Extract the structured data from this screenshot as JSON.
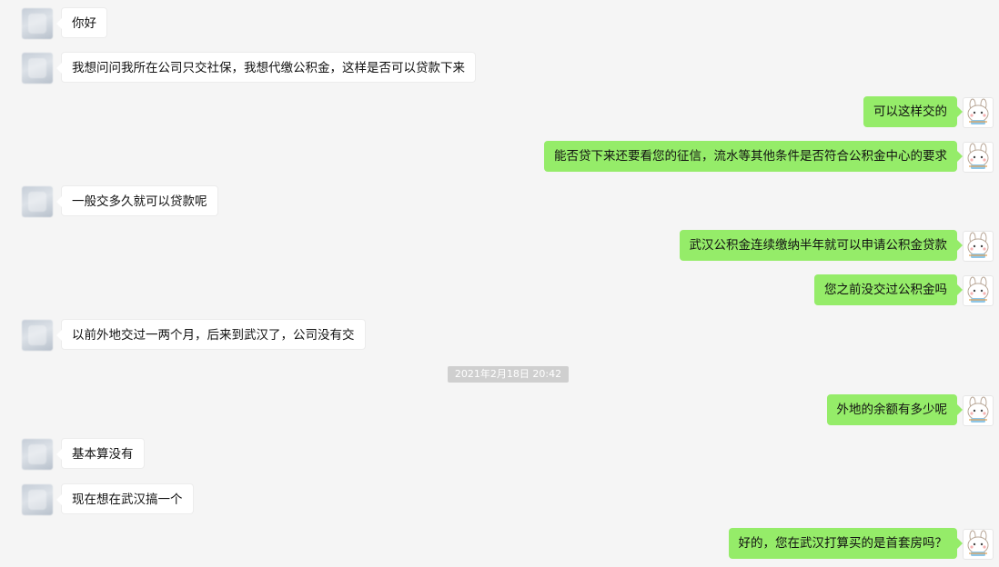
{
  "messages": [
    {
      "side": "left",
      "text": "你好"
    },
    {
      "side": "left",
      "text": "我想问问我所在公司只交社保，我想代缴公积金，这样是否可以贷款下来"
    },
    {
      "side": "right",
      "text": "可以这样交的"
    },
    {
      "side": "right",
      "text": "能否贷下来还要看您的征信，流水等其他条件是否符合公积金中心的要求"
    },
    {
      "side": "left",
      "text": "一般交多久就可以贷款呢"
    },
    {
      "side": "right",
      "text": "武汉公积金连续缴纳半年就可以申请公积金贷款"
    },
    {
      "side": "right",
      "text": "您之前没交过公积金吗"
    },
    {
      "side": "left",
      "text": "以前外地交过一两个月，后来到武汉了，公司没有交"
    },
    {
      "side": "right",
      "text": "外地的余额有多少呢"
    },
    {
      "side": "left",
      "text": "基本算没有"
    },
    {
      "side": "left",
      "text": "现在想在武汉搞一个"
    },
    {
      "side": "right",
      "text": "好的，您在武汉打算买的是首套房吗？"
    }
  ],
  "timestamp": "2021年2月18日 20:42",
  "colors": {
    "background": "#f5f5f5",
    "incoming_bubble": "#ffffff",
    "outgoing_bubble": "#95ec69",
    "timestamp_bg": "#cfcfcf"
  },
  "icons": {
    "incoming_avatar": "blurred-user-avatar",
    "outgoing_avatar": "cartoon-bunny-avatar"
  }
}
